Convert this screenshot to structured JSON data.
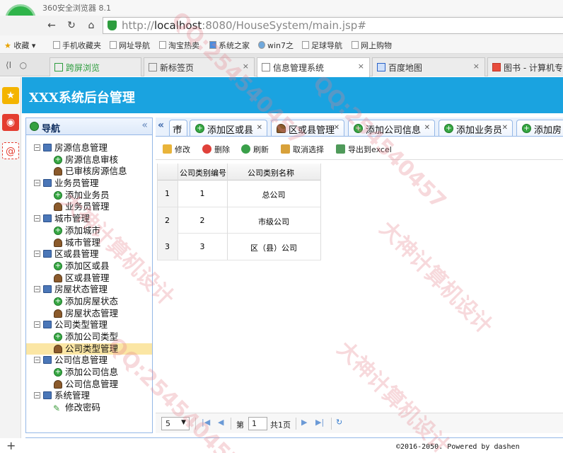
{
  "browser": {
    "title": "360安全浏览器 8.1",
    "url_prefix": "http://",
    "url_host": "localhost",
    "url_rest": ":8080/HouseSystem/main.jsp#",
    "favorites": [
      "收藏",
      "手机收藏夹",
      "网址导航",
      "淘宝热卖",
      "系统之家",
      "win7之",
      "足球导航",
      "网上购物"
    ],
    "tabs": [
      {
        "label": "跨屏浏览"
      },
      {
        "label": "新标签页"
      },
      {
        "label": "信息管理系统"
      },
      {
        "label": "百度地图"
      },
      {
        "label": "图书 - 计算机专业"
      }
    ]
  },
  "app": {
    "title": "XXX系统后台管理"
  },
  "nav": {
    "title": "导航",
    "tree": [
      {
        "label": "房源信息管理",
        "type": "group"
      },
      {
        "label": "房源信息审核",
        "type": "add"
      },
      {
        "label": "已审核房源信息",
        "type": "user"
      },
      {
        "label": "业务员管理",
        "type": "group"
      },
      {
        "label": "添加业务员",
        "type": "add"
      },
      {
        "label": "业务员管理",
        "type": "user"
      },
      {
        "label": "城市管理",
        "type": "group"
      },
      {
        "label": "添加城市",
        "type": "add"
      },
      {
        "label": "城市管理",
        "type": "user"
      },
      {
        "label": "区或县管理",
        "type": "group"
      },
      {
        "label": "添加区或县",
        "type": "add"
      },
      {
        "label": "区或县管理",
        "type": "user"
      },
      {
        "label": "房屋状态管理",
        "type": "group"
      },
      {
        "label": "添加房屋状态",
        "type": "add"
      },
      {
        "label": "房屋状态管理",
        "type": "user"
      },
      {
        "label": "公司类型管理",
        "type": "group"
      },
      {
        "label": "添加公司类型",
        "type": "add"
      },
      {
        "label": "公司类型管理",
        "type": "user"
      },
      {
        "label": "公司信息管理",
        "type": "group"
      },
      {
        "label": "添加公司信息",
        "type": "add"
      },
      {
        "label": "公司信息管理",
        "type": "user"
      },
      {
        "label": "系统管理",
        "type": "group"
      },
      {
        "label": "修改密码",
        "type": "pen"
      }
    ]
  },
  "content_tabs": [
    {
      "label": "市",
      "icon": "none"
    },
    {
      "label": "添加区或县",
      "icon": "add"
    },
    {
      "label": "区或县管理",
      "icon": "user"
    },
    {
      "label": "添加公司信息",
      "icon": "add"
    },
    {
      "label": "添加业务员",
      "icon": "add"
    },
    {
      "label": "添加房",
      "icon": "add"
    }
  ],
  "toolbar": {
    "edit": "修改",
    "delete": "删除",
    "refresh": "刷新",
    "unselect": "取消选择",
    "export": "导出到excel"
  },
  "grid": {
    "columns": [
      "公司类别编号",
      "公司类别名称"
    ],
    "rows": [
      {
        "num": "1",
        "id": "1",
        "name": "总公司"
      },
      {
        "num": "2",
        "id": "2",
        "name": "市级公司"
      },
      {
        "num": "3",
        "id": "3",
        "name": "区（县）公司"
      }
    ]
  },
  "pager": {
    "page_size": "5",
    "page_prefix": "第",
    "page_value": "1",
    "page_total": "共1页"
  },
  "footer": {
    "text": "©2016-2050. Powered by dashen"
  },
  "watermark": {
    "texts": [
      "QQ:254540457",
      "大神计算机设计",
      "QQ:254540457",
      "大神计算机设计",
      "QQ:254540457",
      "大神计算机设计"
    ]
  }
}
